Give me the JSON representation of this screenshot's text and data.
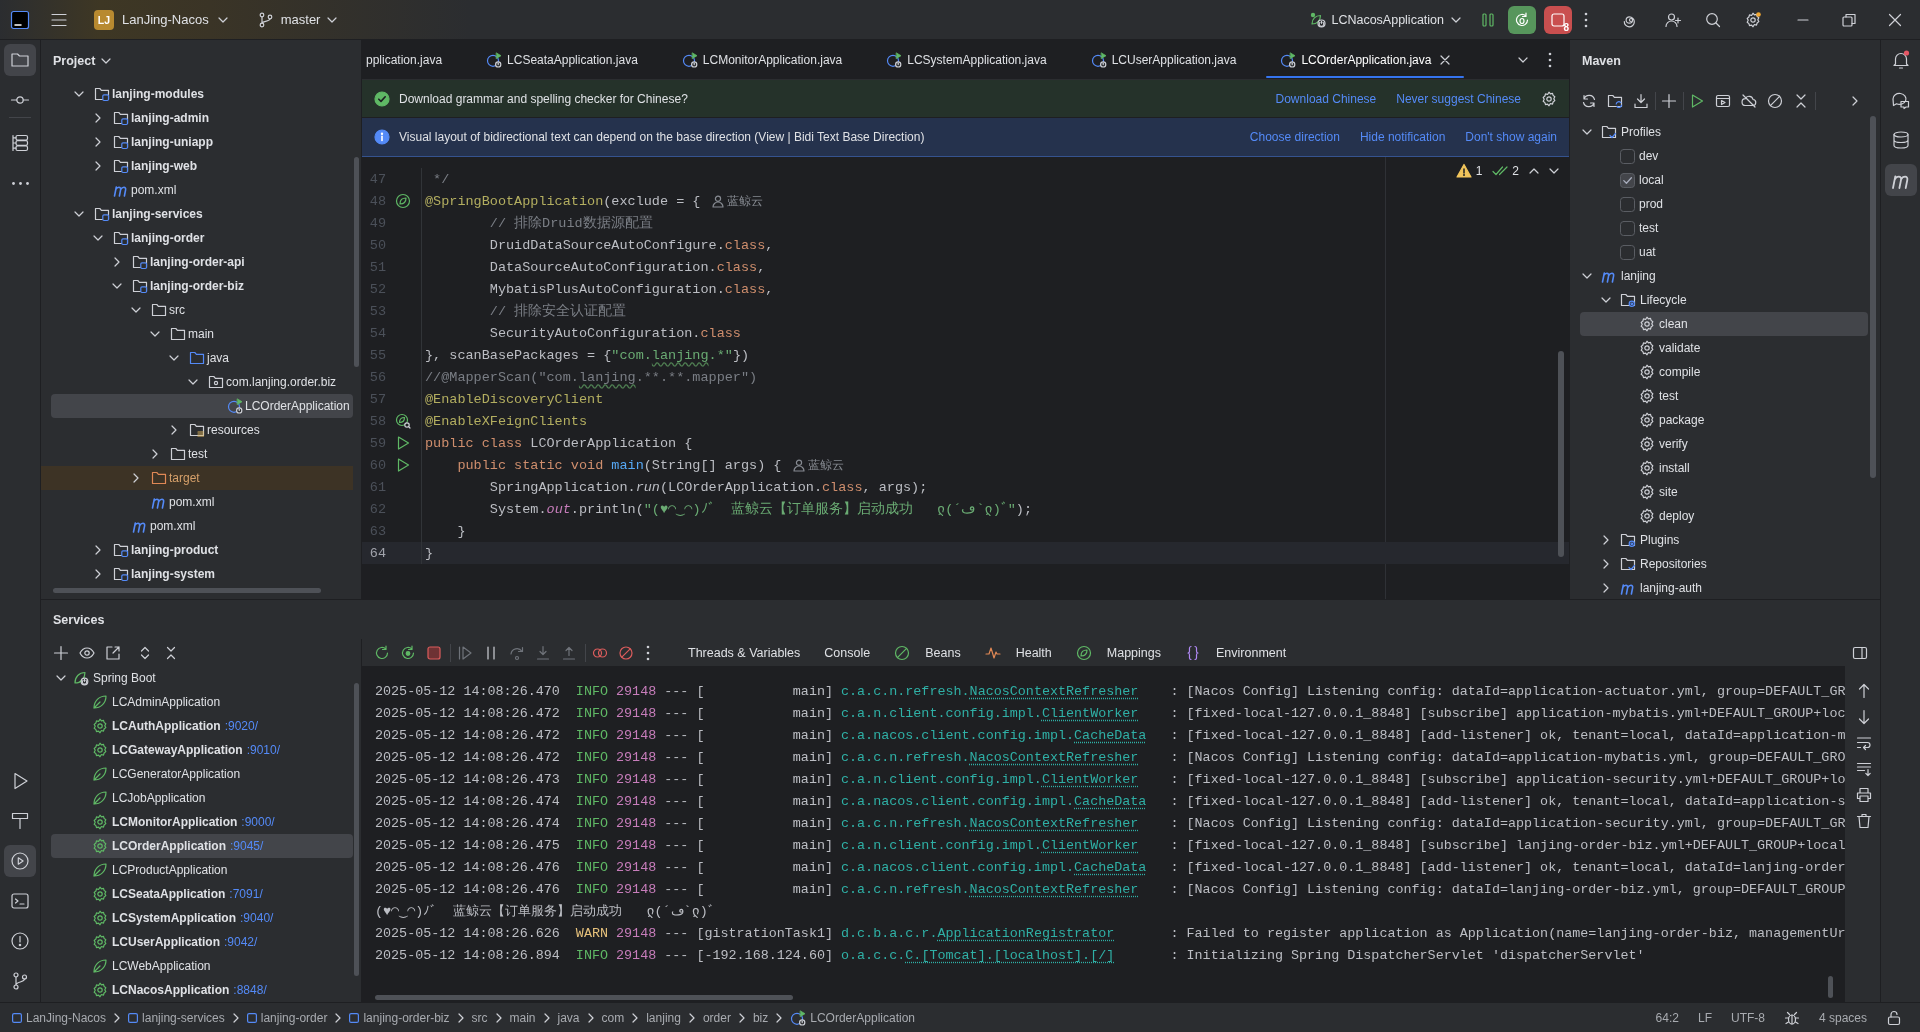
{
  "title_bar": {
    "project_badge": "LJ",
    "project": "LanJing-Nacos",
    "branch": "master",
    "run_config": "LCNacosApplication",
    "stop_count": "8"
  },
  "left_toolbar": {
    "top": [
      {
        "selected": true
      },
      {
        "selected": false
      },
      {
        "selected": false
      },
      {
        "selected": false
      }
    ],
    "bottom": [
      {
        "selected": false
      },
      {
        "selected": false
      },
      {
        "selected": true
      },
      {
        "selected": false
      },
      {
        "selected": false
      },
      {
        "selected": false
      }
    ]
  },
  "right_toolbar": [
    {
      "selected": false
    },
    {
      "selected": false
    },
    {
      "selected": false
    },
    {
      "selected": true
    }
  ],
  "project": {
    "title": "Project",
    "tree": [
      {
        "label": "lanjing-modules",
        "kind": "module",
        "expanded": true,
        "selected": false,
        "children": [
          {
            "label": "lanjing-admin",
            "kind": "module",
            "expanded": false,
            "selected": false
          },
          {
            "label": "lanjing-uniapp",
            "kind": "module",
            "expanded": false,
            "selected": false
          },
          {
            "label": "lanjing-web",
            "kind": "module",
            "expanded": false,
            "selected": false
          },
          {
            "label": "pom.xml",
            "kind": "pom",
            "selected": false
          }
        ]
      },
      {
        "label": "lanjing-services",
        "kind": "module",
        "expanded": true,
        "selected": false,
        "children": [
          {
            "label": "lanjing-order",
            "kind": "module",
            "expanded": true,
            "selected": false,
            "children": [
              {
                "label": "lanjing-order-api",
                "kind": "module",
                "expanded": false,
                "selected": false
              },
              {
                "label": "lanjing-order-biz",
                "kind": "module",
                "expanded": true,
                "selected": false,
                "children": [
                  {
                    "label": "src",
                    "kind": "folder",
                    "expanded": true,
                    "selected": false,
                    "children": [
                      {
                        "label": "main",
                        "kind": "folder",
                        "expanded": true,
                        "selected": false,
                        "children": [
                          {
                            "label": "java",
                            "kind": "source",
                            "expanded": true,
                            "selected": false,
                            "children": [
                              {
                                "label": "com.lanjing.order.biz",
                                "kind": "package",
                                "expanded": true,
                                "selected": false,
                                "children": [
                                  {
                                    "label": "LCOrderApplication",
                                    "kind": "class",
                                    "selected": true
                                  }
                                ]
                              }
                            ]
                          },
                          {
                            "label": "resources",
                            "kind": "resources",
                            "expanded": false,
                            "selected": false
                          }
                        ]
                      },
                      {
                        "label": "test",
                        "kind": "folder",
                        "expanded": false,
                        "selected": false
                      }
                    ]
                  },
                  {
                    "label": "target",
                    "kind": "excluded",
                    "expanded": false,
                    "selected": false
                  },
                  {
                    "label": "pom.xml",
                    "kind": "pom",
                    "selected": false
                  }
                ]
              },
              {
                "label": "pom.xml",
                "kind": "pom",
                "selected": false
              }
            ]
          },
          {
            "label": "lanjing-product",
            "kind": "module",
            "expanded": false,
            "selected": false
          },
          {
            "label": "lanjing-system",
            "kind": "module",
            "expanded": false,
            "selected": false
          }
        ]
      }
    ]
  },
  "editor": {
    "tabs": [
      {
        "label": "pplication.java",
        "clipped": true,
        "selected": false
      },
      {
        "label": "LCSeataApplication.java",
        "clipped": false,
        "selected": false
      },
      {
        "label": "LCMonitorApplication.java",
        "clipped": false,
        "selected": false
      },
      {
        "label": "LCSystemApplication.java",
        "clipped": false,
        "selected": false
      },
      {
        "label": "LCUserApplication.java",
        "clipped": false,
        "selected": false
      },
      {
        "label": "LCOrderApplication.java",
        "clipped": false,
        "selected": true
      }
    ],
    "notifications": [
      {
        "kind": "success",
        "text": "Download grammar and spelling checker for Chinese?",
        "actions": [
          "Download Chinese",
          "Never suggest Chinese"
        ],
        "settings": true
      },
      {
        "kind": "info",
        "text": "Visual layout of bidirectional text can depend on the base direction (View | Bidi Text Base Direction)",
        "actions": [
          "Choose direction",
          "Hide notification",
          "Don't show again"
        ],
        "settings": false
      }
    ],
    "inspections": {
      "warnings": "1",
      "checks": "2"
    },
    "lines": [
      {
        "number": "47",
        "current": false,
        "tokens": [
          {
            "text": " */",
            "kind": "comment"
          }
        ]
      },
      {
        "number": "48",
        "current": false,
        "gutter": {
          "kind": "bean"
        },
        "author": "蓝鲸云",
        "tokens": [
          {
            "text": "@SpringBootApplication",
            "kind": "annotation"
          },
          {
            "text": "(exclude = {",
            "kind": "plain"
          }
        ]
      },
      {
        "number": "49",
        "current": false,
        "tokens": [
          {
            "text": "        // 排除Druid数据源配置",
            "kind": "comment"
          }
        ]
      },
      {
        "number": "50",
        "current": false,
        "tokens": [
          {
            "text": "        DruidDataSourceAutoConfigure.",
            "kind": "plain"
          },
          {
            "text": "class",
            "kind": "keyword"
          },
          {
            "text": ",",
            "kind": "plain"
          }
        ]
      },
      {
        "number": "51",
        "current": false,
        "tokens": [
          {
            "text": "        DataSourceAutoConfiguration.",
            "kind": "plain"
          },
          {
            "text": "class",
            "kind": "keyword"
          },
          {
            "text": ",",
            "kind": "plain"
          }
        ]
      },
      {
        "number": "52",
        "current": false,
        "tokens": [
          {
            "text": "        MybatisPlusAutoConfiguration.",
            "kind": "plain"
          },
          {
            "text": "class",
            "kind": "keyword"
          },
          {
            "text": ",",
            "kind": "plain"
          }
        ]
      },
      {
        "number": "53",
        "current": false,
        "tokens": [
          {
            "text": "        // 排除安全认证配置",
            "kind": "comment"
          }
        ]
      },
      {
        "number": "54",
        "current": false,
        "tokens": [
          {
            "text": "        SecurityAutoConfiguration.",
            "kind": "plain"
          },
          {
            "text": "class",
            "kind": "keyword"
          }
        ]
      },
      {
        "number": "55",
        "current": false,
        "tokens": [
          {
            "text": "}, scanBasePackages = {",
            "kind": "plain"
          },
          {
            "text": "\"com.",
            "kind": "string"
          },
          {
            "text": "lanjing",
            "kind": "string",
            "typo": true
          },
          {
            "text": ".*\"",
            "kind": "string"
          },
          {
            "text": "})",
            "kind": "plain"
          }
        ]
      },
      {
        "number": "56",
        "current": false,
        "tokens": [
          {
            "text": "//@MapperScan(\"com.",
            "kind": "comment"
          },
          {
            "text": "lanjing",
            "kind": "comment",
            "typo": true
          },
          {
            "text": ".**.**.mapper\")",
            "kind": "comment"
          }
        ]
      },
      {
        "number": "57",
        "current": false,
        "tokens": [
          {
            "text": "@EnableDiscoveryClient",
            "kind": "annotation"
          }
        ]
      },
      {
        "number": "58",
        "current": false,
        "gutter": {
          "kind": "bean-search"
        },
        "tokens": [
          {
            "text": "@EnableXFeignClients",
            "kind": "annotation"
          }
        ]
      },
      {
        "number": "59",
        "current": false,
        "gutter": {
          "kind": "run"
        },
        "tokens": [
          {
            "text": "public class",
            "kind": "keyword"
          },
          {
            "text": " LCOrderApplication {",
            "kind": "plain"
          }
        ]
      },
      {
        "number": "60",
        "current": false,
        "gutter": {
          "kind": "run"
        },
        "author": "蓝鲸云",
        "tokens": [
          {
            "text": "    public static void",
            "kind": "keyword"
          },
          {
            "text": " main",
            "kind": "method"
          },
          {
            "text": "(String[] args) {",
            "kind": "plain"
          }
        ]
      },
      {
        "number": "61",
        "current": false,
        "tokens": [
          {
            "text": "        SpringApplication.",
            "kind": "plain"
          },
          {
            "text": "run",
            "kind": "static_call"
          },
          {
            "text": "(LCOrderApplication.",
            "kind": "plain"
          },
          {
            "text": "class",
            "kind": "keyword"
          },
          {
            "text": ", args);",
            "kind": "plain"
          }
        ]
      },
      {
        "number": "62",
        "current": false,
        "tokens": [
          {
            "text": "        System.",
            "kind": "plain"
          },
          {
            "text": "out",
            "kind": "static_field"
          },
          {
            "text": ".println(",
            "kind": "plain"
          },
          {
            "text": "\"(♥◠‿◠)ﾉﾞ  蓝鲸云【订单服务】启动成功   ლ(´ڡ`ლ)ﾞ\"",
            "kind": "string"
          },
          {
            "text": ");",
            "kind": "plain"
          }
        ]
      },
      {
        "number": "63",
        "current": false,
        "tokens": [
          {
            "text": "    }",
            "kind": "plain"
          }
        ]
      },
      {
        "number": "64",
        "current": true,
        "tokens": [
          {
            "text": "}",
            "kind": "plain"
          }
        ]
      }
    ]
  },
  "maven": {
    "title": "Maven",
    "tree": [
      {
        "label": "Profiles",
        "kind": "profiles",
        "expanded": true,
        "selected": false,
        "children": [
          {
            "label": "dev",
            "kind": "profile",
            "checked": false,
            "selected": false
          },
          {
            "label": "local",
            "kind": "profile",
            "checked": true,
            "selected": false
          },
          {
            "label": "prod",
            "kind": "profile",
            "checked": false,
            "selected": false
          },
          {
            "label": "test",
            "kind": "profile",
            "checked": false,
            "selected": false
          },
          {
            "label": "uat",
            "kind": "profile",
            "checked": false,
            "selected": false
          }
        ]
      },
      {
        "label": "lanjing",
        "kind": "project",
        "expanded": true,
        "selected": false,
        "children": [
          {
            "label": "Lifecycle",
            "kind": "lifecycle",
            "expanded": true,
            "selected": false,
            "children": [
              {
                "label": "clean",
                "kind": "goal",
                "selected": true
              },
              {
                "label": "validate",
                "kind": "goal",
                "selected": false
              },
              {
                "label": "compile",
                "kind": "goal",
                "selected": false
              },
              {
                "label": "test",
                "kind": "goal",
                "selected": false
              },
              {
                "label": "package",
                "kind": "goal",
                "selected": false
              },
              {
                "label": "verify",
                "kind": "goal",
                "selected": false
              },
              {
                "label": "install",
                "kind": "goal",
                "selected": false
              },
              {
                "label": "site",
                "kind": "goal",
                "selected": false
              },
              {
                "label": "deploy",
                "kind": "goal",
                "selected": false
              }
            ]
          },
          {
            "label": "Plugins",
            "kind": "plugins",
            "expanded": false,
            "selected": false
          },
          {
            "label": "Repositories",
            "kind": "repositories",
            "expanded": false,
            "selected": false
          },
          {
            "label": "lanjing-auth",
            "kind": "project",
            "expanded": false,
            "selected": false
          }
        ]
      }
    ]
  },
  "services": {
    "title": "Services",
    "tree": [
      {
        "label": "Spring Boot",
        "expanded": true,
        "selected": false,
        "children": [
          {
            "label": "LCAdminApplication",
            "running": false,
            "selected": false
          },
          {
            "label": "LCAuthApplication",
            "port": ":9020/",
            "running": true,
            "selected": false
          },
          {
            "label": "LCGatewayApplication",
            "port": ":9010/",
            "running": true,
            "selected": false
          },
          {
            "label": "LCGeneratorApplication",
            "running": false,
            "selected": false
          },
          {
            "label": "LCJobApplication",
            "running": false,
            "selected": false
          },
          {
            "label": "LCMonitorApplication",
            "port": ":9000/",
            "running": true,
            "selected": false
          },
          {
            "label": "LCOrderApplication",
            "port": ":9045/",
            "running": true,
            "selected": true
          },
          {
            "label": "LCProductApplication",
            "running": false,
            "selected": false
          },
          {
            "label": "LCSeataApplication",
            "port": ":7091/",
            "running": true,
            "selected": false
          },
          {
            "label": "LCSystemApplication",
            "port": ":9040/",
            "running": true,
            "selected": false
          },
          {
            "label": "LCUserApplication",
            "port": ":9042/",
            "running": true,
            "selected": false
          },
          {
            "label": "LCWebApplication",
            "running": false,
            "selected": false
          },
          {
            "label": "LCNacosApplication",
            "port": ":8848/",
            "running": true,
            "selected": false
          }
        ]
      }
    ],
    "console_tabs": [
      {
        "label": "Threads & Variables"
      },
      {
        "label": "Console"
      },
      {
        "label": "Beans"
      },
      {
        "label": "Health"
      },
      {
        "label": "Mappings"
      },
      {
        "label": "Environment"
      }
    ],
    "console": [
      {
        "kind": "info",
        "time": "2025-05-12 14:08:26.470",
        "level": "INFO",
        "pid": "29148",
        "dashes": "---",
        "thread": "[           main]",
        "logger": "c.a.c.n.refresh.",
        "logger_class": "NacosContextRefresher",
        "sep": ":",
        "message": "[Nacos Config] Listening config: dataId=application-actuator.yml, group=DEFAULT_GR"
      },
      {
        "kind": "info",
        "time": "2025-05-12 14:08:26.472",
        "level": "INFO",
        "pid": "29148",
        "dashes": "---",
        "thread": "[           main]",
        "logger": "c.a.n.client.config.impl.",
        "logger_class": "ClientWorker",
        "sep": ":",
        "message": "[fixed-local-127.0.0.1_8848] [subscribe] application-mybatis.yml+DEFAULT_GROUP+loc"
      },
      {
        "kind": "info",
        "time": "2025-05-12 14:08:26.472",
        "level": "INFO",
        "pid": "29148",
        "dashes": "---",
        "thread": "[           main]",
        "logger": "c.a.nacos.client.config.impl.",
        "logger_class": "CacheData",
        "sep": ":",
        "message": "[fixed-local-127.0.0.1_8848] [add-listener] ok, tenant=local, dataId=application-m"
      },
      {
        "kind": "info",
        "time": "2025-05-12 14:08:26.472",
        "level": "INFO",
        "pid": "29148",
        "dashes": "---",
        "thread": "[           main]",
        "logger": "c.a.c.n.refresh.",
        "logger_class": "NacosContextRefresher",
        "sep": ":",
        "message": "[Nacos Config] Listening config: dataId=application-mybatis.yml, group=DEFAULT_GRO"
      },
      {
        "kind": "info",
        "time": "2025-05-12 14:08:26.473",
        "level": "INFO",
        "pid": "29148",
        "dashes": "---",
        "thread": "[           main]",
        "logger": "c.a.n.client.config.impl.",
        "logger_class": "ClientWorker",
        "sep": ":",
        "message": "[fixed-local-127.0.0.1_8848] [subscribe] application-security.yml+DEFAULT_GROUP+lo"
      },
      {
        "kind": "info",
        "time": "2025-05-12 14:08:26.474",
        "level": "INFO",
        "pid": "29148",
        "dashes": "---",
        "thread": "[           main]",
        "logger": "c.a.nacos.client.config.impl.",
        "logger_class": "CacheData",
        "sep": ":",
        "message": "[fixed-local-127.0.0.1_8848] [add-listener] ok, tenant=local, dataId=application-s"
      },
      {
        "kind": "info",
        "time": "2025-05-12 14:08:26.474",
        "level": "INFO",
        "pid": "29148",
        "dashes": "---",
        "thread": "[           main]",
        "logger": "c.a.c.n.refresh.",
        "logger_class": "NacosContextRefresher",
        "sep": ":",
        "message": "[Nacos Config] Listening config: dataId=application-security.yml, group=DEFAULT_GR"
      },
      {
        "kind": "info",
        "time": "2025-05-12 14:08:26.475",
        "level": "INFO",
        "pid": "29148",
        "dashes": "---",
        "thread": "[           main]",
        "logger": "c.a.n.client.config.impl.",
        "logger_class": "ClientWorker",
        "sep": ":",
        "message": "[fixed-local-127.0.0.1_8848] [subscribe] lanjing-order-biz.yml+DEFAULT_GROUP+local"
      },
      {
        "kind": "info",
        "time": "2025-05-12 14:08:26.476",
        "level": "INFO",
        "pid": "29148",
        "dashes": "---",
        "thread": "[           main]",
        "logger": "c.a.nacos.client.config.impl.",
        "logger_class": "CacheData",
        "sep": ":",
        "message": "[fixed-local-127.0.0.1_8848] [add-listener] ok, tenant=local, dataId=lanjing-order"
      },
      {
        "kind": "info",
        "time": "2025-05-12 14:08:26.476",
        "level": "INFO",
        "pid": "29148",
        "dashes": "---",
        "thread": "[           main]",
        "logger": "c.a.c.n.refresh.",
        "logger_class": "NacosContextRefresher",
        "sep": ":",
        "message": "[Nacos Config] Listening config: dataId=lanjing-order-biz.yml, group=DEFAULT_GROUP"
      },
      {
        "kind": "plain",
        "text": "(♥◠‿◠)ﾉﾞ  蓝鲸云【订单服务】启动成功   ლ(´ڡ`ლ)ﾞ"
      },
      {
        "kind": "warn",
        "time": "2025-05-12 14:08:26.626",
        "level": "WARN",
        "pid": "29148",
        "dashes": "---",
        "thread": "[gistrationTask1]",
        "logger": "d.c.b.a.c.r.",
        "logger_class": "ApplicationRegistrator",
        "sep": ":",
        "message": "Failed to register application as Application(name=lanjing-order-biz, managementUr"
      },
      {
        "kind": "info",
        "time": "2025-05-12 14:08:26.894",
        "level": "INFO",
        "pid": "29148",
        "dashes": "---",
        "thread": "[-192.168.124.60]",
        "logger": "o.a.c.c.",
        "logger_class": "C.[Tomcat].[localhost].[/]",
        "sep": ":",
        "message": "Initializing Spring DispatcherServlet 'dispatcherServlet'"
      }
    ]
  },
  "status_bar": {
    "breadcrumbs": [
      {
        "label": "LanJing-Nacos",
        "kind": "module"
      },
      {
        "label": "lanjing-services",
        "kind": "module"
      },
      {
        "label": "lanjing-order",
        "kind": "module"
      },
      {
        "label": "lanjing-order-biz",
        "kind": "module"
      },
      {
        "label": "src",
        "kind": "plain"
      },
      {
        "label": "main",
        "kind": "plain"
      },
      {
        "label": "java",
        "kind": "plain"
      },
      {
        "label": "com",
        "kind": "plain"
      },
      {
        "label": "lanjing",
        "kind": "plain"
      },
      {
        "label": "order",
        "kind": "plain"
      },
      {
        "label": "biz",
        "kind": "plain"
      },
      {
        "label": "LCOrderApplication",
        "kind": "class"
      }
    ],
    "position": "64:2",
    "line_separator": "LF",
    "encoding": "UTF-8",
    "indent": "4 spaces"
  }
}
